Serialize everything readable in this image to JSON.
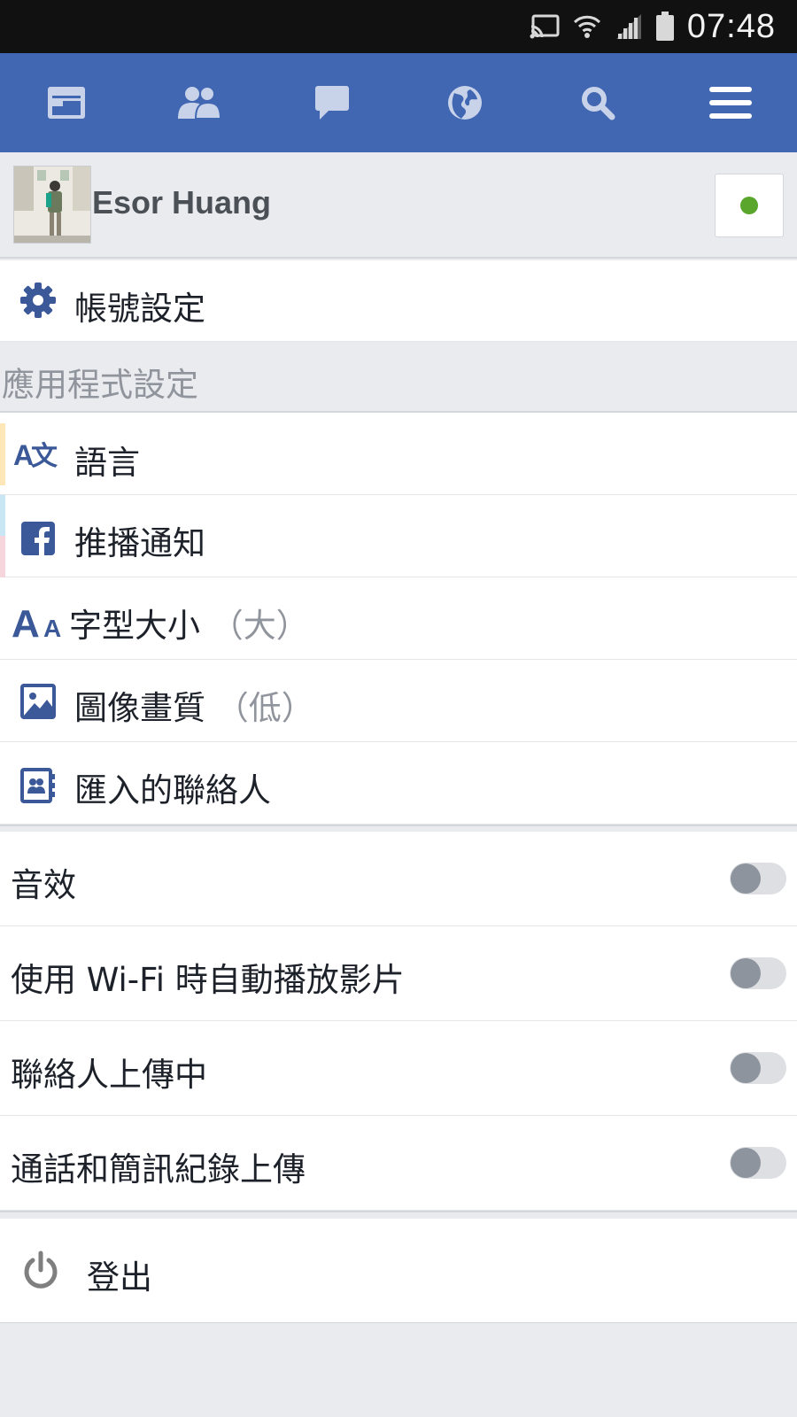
{
  "status_bar": {
    "time": "07:48",
    "icons": [
      "cast-icon",
      "wifi-icon",
      "signal-icon",
      "battery-icon"
    ]
  },
  "top_nav": {
    "items": [
      "news-feed-icon",
      "friends-icon",
      "messages-icon",
      "notifications-globe-icon",
      "search-icon",
      "menu-icon"
    ]
  },
  "profile": {
    "name": "Esor Huang",
    "online_status_color": "#5aa62d"
  },
  "account": {
    "label": "帳號設定",
    "icon": "gear-icon"
  },
  "app_settings": {
    "header": "應用程式設定",
    "items": [
      {
        "label": "語言",
        "suffix": "",
        "icon": "translate-icon"
      },
      {
        "label": "推播通知",
        "suffix": "",
        "icon": "facebook-icon"
      },
      {
        "label": "字型大小",
        "suffix": "（大）",
        "icon": "font-size-icon"
      },
      {
        "label": "圖像畫質",
        "suffix": "（低）",
        "icon": "image-icon"
      },
      {
        "label": "匯入的聯絡人",
        "suffix": "",
        "icon": "contacts-icon"
      }
    ]
  },
  "toggles": [
    {
      "label": "音效",
      "on": false
    },
    {
      "label": "使用 Wi-Fi 時自動播放影片",
      "on": false
    },
    {
      "label": "聯絡人上傳中",
      "on": false
    },
    {
      "label": "通話和簡訊紀錄上傳",
      "on": false
    }
  ],
  "logout": {
    "label": "登出",
    "icon": "power-icon"
  },
  "colors": {
    "brand": "#4267b2",
    "icon_blue": "#3b5998",
    "background": "#e9ebee"
  }
}
